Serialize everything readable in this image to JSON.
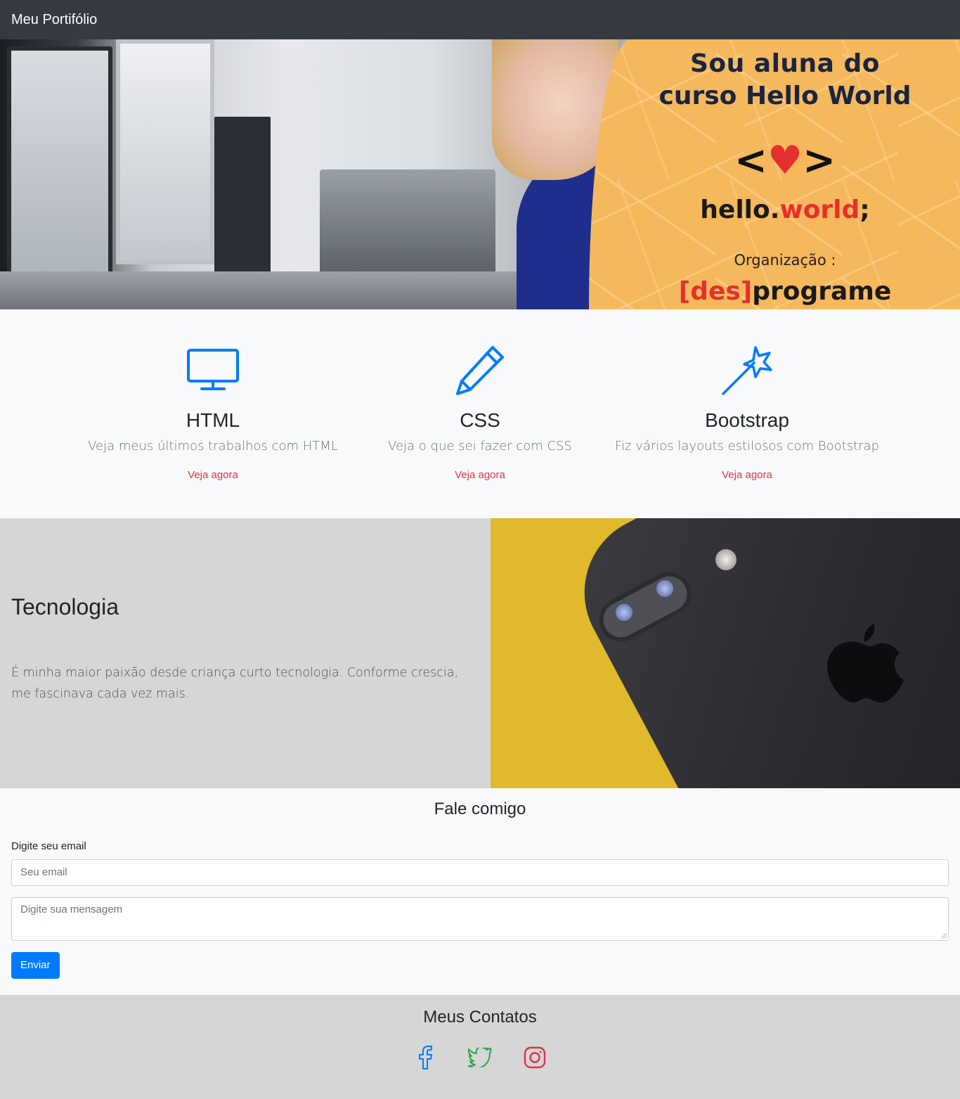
{
  "navbar": {
    "brand": "Meu Portifólio"
  },
  "hero": {
    "line1": "Sou aluna do",
    "line2": "curso Hello World",
    "code_left": "<",
    "code_right": ">",
    "hello": "hello.",
    "world": "world",
    "semicolon": ";",
    "org_label": "Organização :",
    "des": "[des]",
    "programe": "programe"
  },
  "features": [
    {
      "icon": "monitor-icon",
      "title": "HTML",
      "text": "Veja meus últimos trabalhos com HTML",
      "link": "Veja agora"
    },
    {
      "icon": "pencil-icon",
      "title": "CSS",
      "text": "Veja o que sei fazer com CSS",
      "link": "Veja agora"
    },
    {
      "icon": "magic-wand-icon",
      "title": "Bootstrap",
      "text": "Fiz vários layouts estilosos com Bootstrap",
      "link": "Veja agora"
    }
  ],
  "tech": {
    "title": "Tecnologia",
    "text": "É minha maior paixão desde criança curto tecnologia. Conforme crescia, me fascinava cada vez mais."
  },
  "contact": {
    "title": "Fale comigo",
    "email_label": "Digite seu email",
    "email_placeholder": "Seu email",
    "message_placeholder": "Digite sua mensagem",
    "submit": "Enviar"
  },
  "footer": {
    "title": "Meus Contatos",
    "icons": [
      "facebook-icon",
      "twitter-icon",
      "instagram-icon"
    ]
  },
  "colors": {
    "navbar": "#343a40",
    "primary": "#007bff",
    "link": "#dc3545",
    "section_gray": "#d6d6d6",
    "facebook": "#007bff",
    "twitter": "#28a745",
    "instagram": "#dc3545"
  }
}
